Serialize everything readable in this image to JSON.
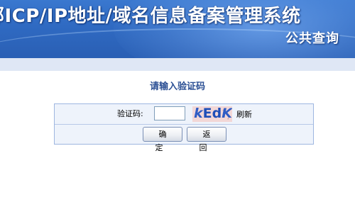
{
  "header": {
    "title": "部ICP/IP地址/域名信息备案管理系统",
    "subtitle": "公共查询"
  },
  "verify": {
    "heading": "请输入验证码",
    "code_label": "验证码:",
    "input_value": "",
    "captcha_text_a": "k",
    "captcha_text_b": "Ed",
    "captcha_text_c": "K",
    "refresh_label": "刷新",
    "confirm_label": "确 定",
    "back_label": "返 回"
  }
}
